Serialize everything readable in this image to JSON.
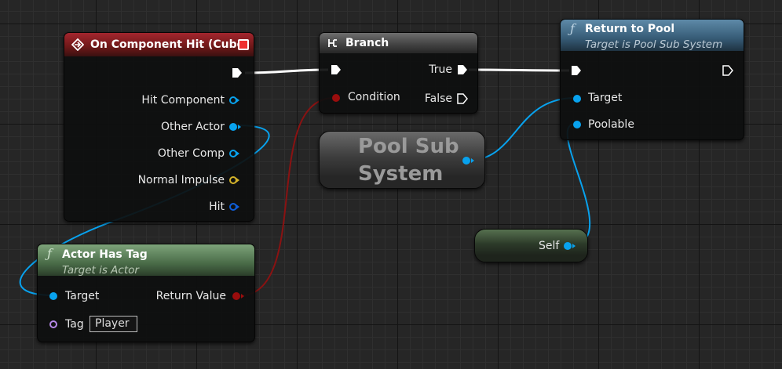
{
  "nodes": {
    "on_component_hit": {
      "title": "On Component Hit (Cube)",
      "pins": {
        "hit_component": "Hit Component",
        "other_actor": "Other Actor",
        "other_comp": "Other Comp",
        "normal_impulse": "Normal Impulse",
        "hit": "Hit"
      }
    },
    "branch": {
      "title": "Branch",
      "pins": {
        "condition": "Condition",
        "true": "True",
        "false": "False"
      }
    },
    "return_to_pool": {
      "title": "Return to Pool",
      "subtitle": "Target is Pool Sub System",
      "pins": {
        "target": "Target",
        "poolable": "Poolable"
      }
    },
    "pool_sub_system": {
      "label_line1": "Pool Sub",
      "label_line2": "System"
    },
    "self": {
      "label": "Self"
    },
    "actor_has_tag": {
      "title": "Actor Has Tag",
      "subtitle": "Target is Actor",
      "pins": {
        "target": "Target",
        "return_value": "Return Value",
        "tag": "Tag"
      },
      "tag_value": "Player"
    }
  },
  "colors": {
    "object_pin": "#08a2ee",
    "bool_pin": "#9a0d0d",
    "vector_pin": "#d4b32a",
    "struct_pin": "#0f5ed8",
    "name_pin": "#b688e8",
    "exec_wire": "#ffffff"
  },
  "icons": {
    "event": "event-diamond-icon",
    "branch": "branch-icon",
    "function": "function-f-icon",
    "delegate": "delegate-square-icon"
  }
}
